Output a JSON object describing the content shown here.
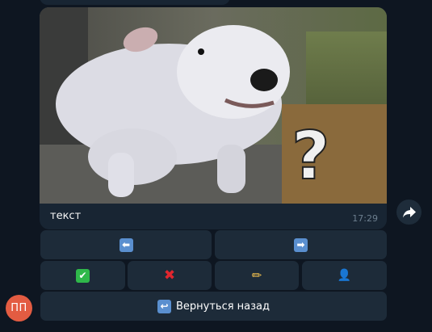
{
  "message": {
    "caption": "текст",
    "time": "17:29",
    "image_overlay_symbol": "?",
    "image_description": "photo-white-dog"
  },
  "keyboard": {
    "nav_row": [
      {
        "icon": "left-arrow-icon",
        "symbol": "⬅"
      },
      {
        "icon": "right-arrow-icon",
        "symbol": "➡"
      }
    ],
    "action_row": [
      {
        "icon": "check-mark-icon",
        "symbol": "✔"
      },
      {
        "icon": "cross-mark-icon",
        "symbol": "✖"
      },
      {
        "icon": "pencil-icon",
        "symbol": "✏"
      },
      {
        "icon": "user-silhouette-icon",
        "symbol": "👤"
      }
    ],
    "back_button": {
      "icon": "return-arrow-icon",
      "symbol": "↩",
      "label": "Вернуться назад"
    }
  },
  "sender": {
    "avatar_initials": "ПП",
    "avatar_color": "#e35c42"
  },
  "colors": {
    "background": "#0e1621",
    "bubble": "#182533",
    "button": "#1d2b39",
    "time_text": "#6d7f8f",
    "emoji_blue_box": "#5a8fcf",
    "emoji_green_box": "#2fb84a",
    "emoji_red_cross": "#e0262e"
  }
}
